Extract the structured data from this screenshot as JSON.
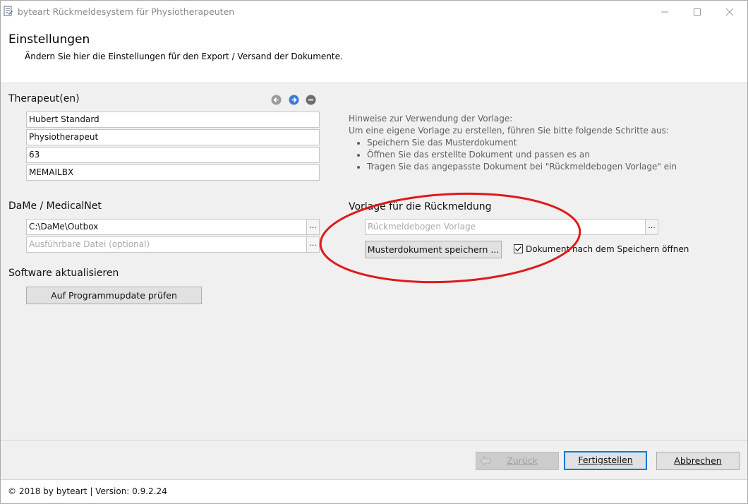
{
  "window": {
    "title": "byteart Rückmeldesystem für Physiotherapeuten",
    "controls": {
      "minimize": "minimize",
      "maximize": "maximize",
      "close": "close"
    }
  },
  "header": {
    "title": "Einstellungen",
    "subtitle": "Ändern Sie hier die Einstellungen für den Export / Versand der Dokumente."
  },
  "therapist": {
    "title": "Therapeut(en)",
    "fields": [
      "Hubert Standard",
      "Physiotherapeut",
      "63",
      "MEMAILBX"
    ]
  },
  "dame": {
    "title": "DaMe / MedicalNet",
    "outbox": "C:\\DaMe\\Outbox",
    "executable_placeholder": "Ausführbare Datei (optional)",
    "browse": "..."
  },
  "software": {
    "title": "Software aktualisieren",
    "update_button": "Auf Programmupdate prüfen"
  },
  "hints": {
    "line1": "Hinweise zur Verwendung der Vorlage:",
    "line2": "Um eine eigene Vorlage zu erstellen, führen Sie bitte folgende Schritte aus:",
    "steps": [
      "Speichern Sie das Musterdokument",
      "Öffnen Sie das erstellte Dokument und passen es an",
      "Tragen Sie das angepasste Dokument bei \"Rückmeldebogen Vorlage\" ein"
    ]
  },
  "template": {
    "title": "Vorlage für die Rückmeldung",
    "field_placeholder": "Rückmeldebogen Vorlage",
    "save_button": "Musterdokument speichern ...",
    "open_checkbox_label": "Dokument nach dem Speichern öffnen",
    "open_checkbox_checked": true
  },
  "footer": {
    "back_prefix": "",
    "back_label": "Zurück",
    "finish_label": "Fertigstellen",
    "cancel_label": "Abbrechen"
  },
  "status": {
    "text": "© 2018 by byteart  | Version: 0.9.2.24"
  },
  "colors": {
    "annotation": "#e01919",
    "accent": "#0078d7",
    "nav_active": "#3a7bd5"
  }
}
